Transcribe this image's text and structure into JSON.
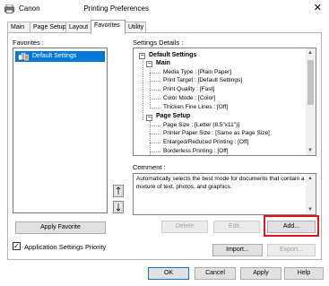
{
  "window": {
    "title": "Canon                      Printing Preferences",
    "close_glyph": "✕"
  },
  "tabs": [
    {
      "label": "Main"
    },
    {
      "label": "Page Setup"
    },
    {
      "label": "Layout"
    },
    {
      "label": "Favorites"
    },
    {
      "label": "Utility"
    }
  ],
  "favorites": {
    "label": "Favorites :",
    "items": [
      {
        "label": "Default Settings"
      }
    ],
    "apply_button": "Apply Favorite",
    "move_up_glyph": "↑",
    "move_down_glyph": "↓"
  },
  "settings_details": {
    "label": "Settings Details :",
    "root": "Default Settings",
    "main_group": "Main",
    "main_items": [
      "Media Type : [Plain Paper]",
      "Print Target : [Default Settings]",
      "Print Quality : [Fast]",
      "Color Mode : [Color]",
      "Thicken Fine Lines : [Off]"
    ],
    "page_setup_group": "Page Setup",
    "page_setup_items": [
      "Page Size : [Letter (8.5\"x11\")]",
      "Printer Paper Size : [Same as Page Size]",
      "Enlarged/Reduced Printing : [Off]",
      "Borderless Printing : [Off]"
    ]
  },
  "comment": {
    "label": "Comment :",
    "text": "Automatically selects the best mode for documents that contain a mixture of text, photos, and graphics."
  },
  "actions": {
    "delete": "Delete",
    "edit": "Edit...",
    "add": "Add...",
    "import": "Import...",
    "export": "Export..."
  },
  "options": {
    "app_settings_priority": "Application Settings Priority",
    "checked": true,
    "check_glyph": "✓"
  },
  "footer": {
    "ok": "OK",
    "cancel": "Cancel",
    "apply": "Apply",
    "help": "Help"
  },
  "colors": {
    "selection": "#0078d7",
    "highlight_border": "#e0141e"
  }
}
